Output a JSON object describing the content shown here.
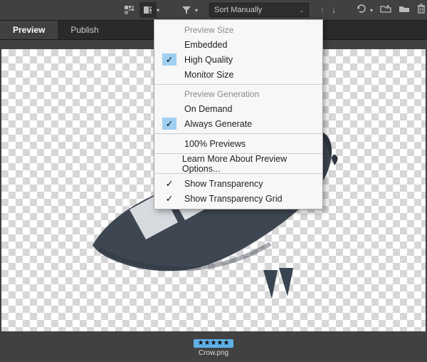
{
  "toolbar": {
    "sort_label": "Sort Manually",
    "icons": {
      "thumb_grid": "thumb-grid-icon",
      "thumb_quality": "thumb-quality-icon",
      "filter": "filter-icon",
      "sort_asc": "sort-asc-icon",
      "sort_desc": "sort-desc-icon",
      "rotate": "rotate-icon",
      "new_folder": "new-folder-icon",
      "folder": "folder-icon",
      "trash": "trash-icon"
    }
  },
  "tabs": {
    "preview": "Preview",
    "publish": "Publish"
  },
  "menu": {
    "section1_header": "Preview Size",
    "embedded": "Embedded",
    "high_quality": "High Quality",
    "monitor_size": "Monitor Size",
    "section2_header": "Preview Generation",
    "on_demand": "On Demand",
    "always_generate": "Always Generate",
    "hundred_percent": "100% Previews",
    "learn_more": "Learn More About Preview Options...",
    "show_transparency": "Show Transparency",
    "show_transparency_grid": "Show Transparency Grid",
    "checked": {
      "high_quality": true,
      "always_generate": true,
      "show_transparency": true,
      "show_transparency_grid": true
    }
  },
  "file": {
    "name": "Crow.png",
    "rating_stars": 5
  },
  "colors": {
    "highlight": "#9ecff2",
    "menu_bg": "#f7f7f7"
  }
}
